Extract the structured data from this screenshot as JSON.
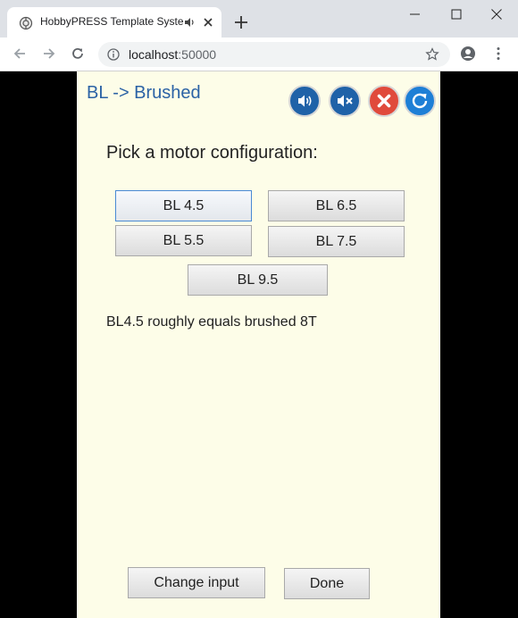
{
  "browser": {
    "tab_title": "HobbyPRESS Template Syste",
    "url_host": "localhost",
    "url_port": ":50000"
  },
  "app": {
    "title": "BL -> Brushed",
    "prompt": "Pick a motor configuration:",
    "options": [
      "BL 4.5",
      "BL 6.5",
      "BL 5.5",
      "BL 7.5",
      "BL 9.5"
    ],
    "selected_option": "BL 4.5",
    "note": "BL4.5 roughly equals brushed 8T",
    "change_input_label": "Change input",
    "done_label": "Done",
    "colors": {
      "background": "#fdfde8",
      "title": "#2b62a5",
      "sound_button": "#1f62a8",
      "close_button": "#e04a3c",
      "refresh_button": "#1e7fd6"
    }
  }
}
